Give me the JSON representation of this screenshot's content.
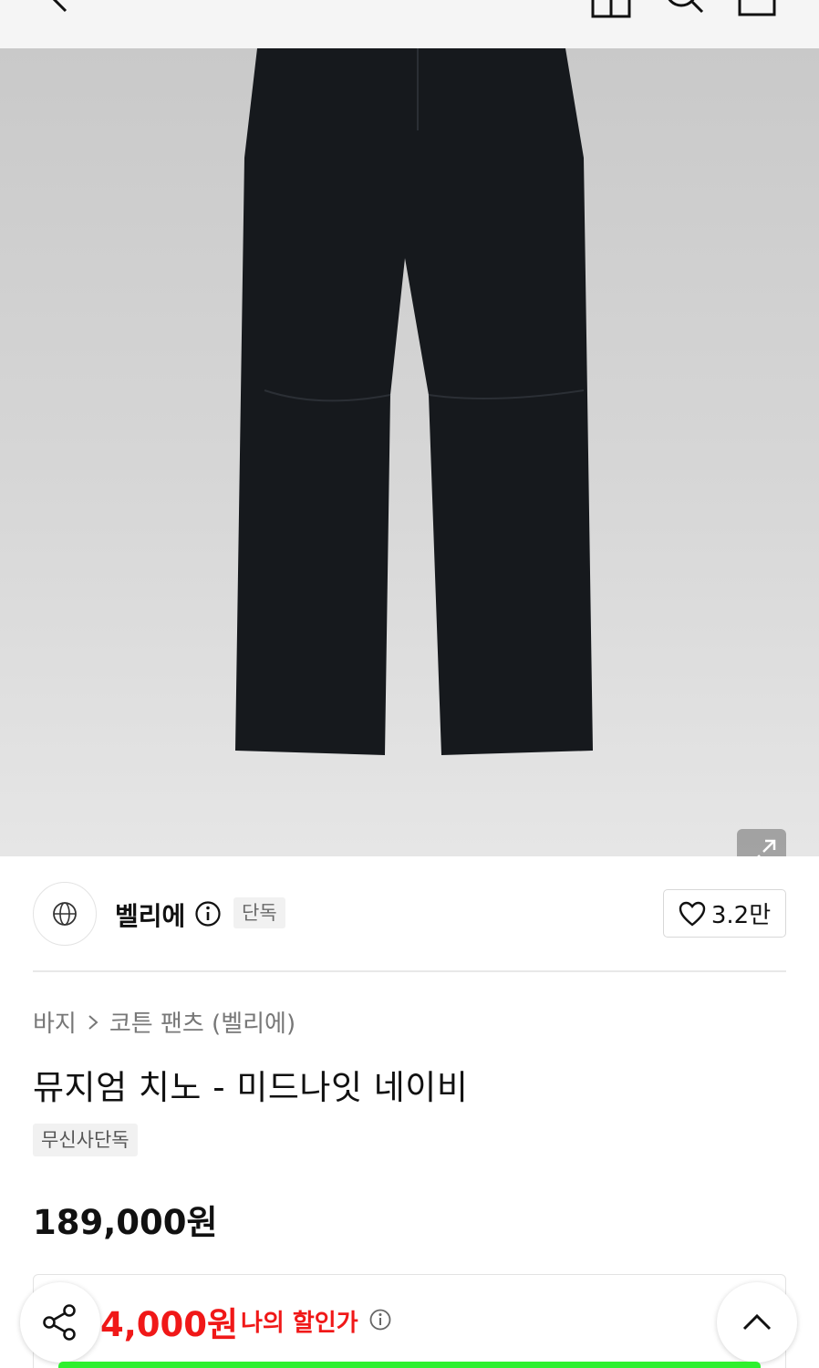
{
  "brand": {
    "name": "벨리에",
    "badge": "단독"
  },
  "like": {
    "count": "3.2만"
  },
  "breadcrumb": {
    "category": "바지",
    "subcategory": "코튼 팬츠 (벨리에)"
  },
  "product": {
    "title": "뮤지엄 치노 - 미드나잇 네이비",
    "tag": "무신사단독",
    "price": "189,000원"
  },
  "discount": {
    "price": "4,000원",
    "label": "나의 할인가"
  },
  "colors": {
    "discount_red": "#f01818",
    "cta_green": "#2ef02e"
  },
  "icons": [
    "back-icon",
    "store-icon",
    "search-icon",
    "cart-icon",
    "expand-icon",
    "brand-logo-icon",
    "info-icon",
    "heart-icon",
    "chevron-right-icon",
    "share-icon",
    "chevron-up-icon"
  ]
}
